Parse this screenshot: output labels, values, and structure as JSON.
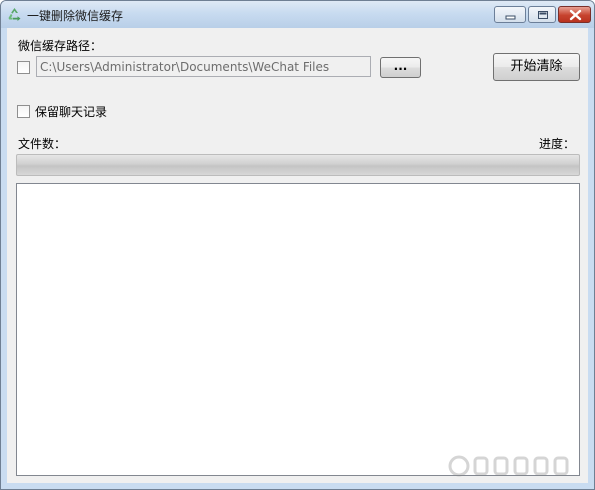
{
  "window": {
    "title": "一键删除微信缓存"
  },
  "form": {
    "path_label": "微信缓存路径：",
    "path_value": "C:\\Users\\Administrator\\Documents\\WeChat Files",
    "browse_label": "...",
    "start_label": "开始清除",
    "keep_chat_label": "保留聊天记录",
    "path_checkbox_checked": false,
    "keep_chat_checked": false
  },
  "status": {
    "file_count_label": "文件数：",
    "progress_label": "进度：",
    "progress_fraction": 0
  },
  "icons": {
    "app": "recycle-icon",
    "minimize": "minimize-icon",
    "maximize": "maximize-icon",
    "close": "close-icon"
  },
  "colors": {
    "titlebar": "#c8dbf0",
    "client_bg": "#f0f0f0",
    "close_button": "#c7432f",
    "progress_fill": "#29c329"
  }
}
